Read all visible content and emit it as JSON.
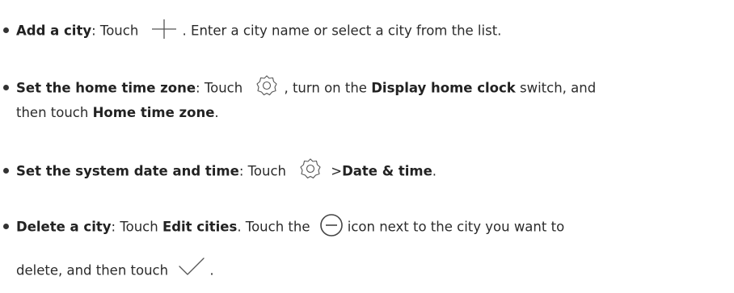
{
  "items": [
    {
      "title": "Add a city",
      "pre_icon": ": Touch",
      "icon": "plus-icon",
      "post_icon": ". Enter a city name or select a city from the list."
    },
    {
      "title": "Set the home time zone",
      "pre_icon": ": Touch",
      "icon": "gear-icon",
      "post_icon": ", turn on the",
      "bold_1": "Display home clock",
      "mid": "switch, and",
      "line2_pre": "then touch",
      "bold_2": "Home time zone",
      "line2_post": "."
    },
    {
      "title": "Set the system date and time",
      "pre_icon": ": Touch",
      "icon": "gear-icon",
      "post_icon": ">",
      "bold_1": "Date & time",
      "end": "."
    },
    {
      "title": "Delete a city",
      "pre_icon": ": Touch",
      "bold_1": "Edit cities",
      "mid": ". Touch the",
      "icon": "minus-circle-icon",
      "post_icon": "icon next to the city you want to",
      "line2_pre": "delete, and then touch",
      "icon_2": "checkmark-icon",
      "line2_post": "."
    }
  ]
}
